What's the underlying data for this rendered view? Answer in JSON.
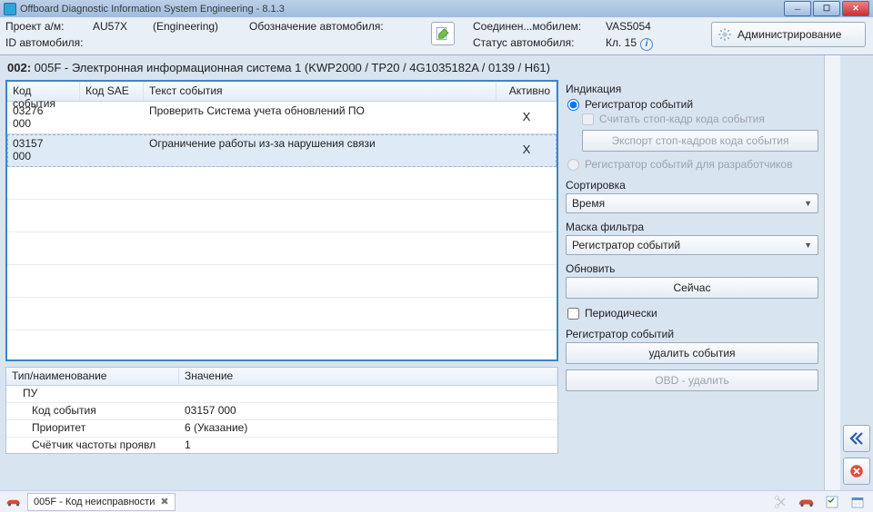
{
  "window": {
    "title": "Offboard Diagnostic Information System Engineering - 8.1.3"
  },
  "header": {
    "project_label": "Проект а/м:",
    "project_value": "AU57X",
    "project_mode": "(Engineering)",
    "vehicle_desig_label": "Обозначение автомобиля:",
    "vehicle_id_label": "ID автомобиля:",
    "conn_label": "Соединен...мобилем:",
    "conn_value": "VAS5054",
    "status_label": "Статус автомобиля:",
    "status_value": "Кл. 15",
    "admin_btn": "Администрирование"
  },
  "ecu_title": {
    "ord": "002:",
    "rest": "005F - Электронная информационная система 1  (KWP2000 / TP20 / 4G1035182A / 0139 / H61)"
  },
  "event_table": {
    "cols": {
      "code": "Код события",
      "sae": "Код SAE",
      "text": "Текст события",
      "active": "Активно"
    },
    "rows": [
      {
        "code1": "03276",
        "code2": "000",
        "sae": "",
        "text": "Проверить Система учета обновлений ПО",
        "active": "X",
        "selected": false
      },
      {
        "code1": "03157",
        "code2": "000",
        "sae": "",
        "text": "Ограничение работы из-за нарушения связи",
        "active": "X",
        "selected": true
      }
    ]
  },
  "details": {
    "cols": {
      "name": "Тип/наименование",
      "value": "Значение"
    },
    "rows": [
      {
        "lvl": 0,
        "name": "ПУ",
        "value": ""
      },
      {
        "lvl": 1,
        "name": "Код события",
        "value": "03157 000"
      },
      {
        "lvl": 1,
        "name": "Приоритет",
        "value": "6  (Указание)"
      },
      {
        "lvl": 1,
        "name": "Счётчик частоты проявл",
        "value": "1"
      }
    ]
  },
  "side": {
    "indication_label": "Индикация",
    "radio_event_log": "Регистратор событий",
    "chk_read_freeze": "Считать стоп-кадр кода события",
    "btn_export_freeze": "Экспорт стоп-кадров кода события",
    "radio_dev_log": "Регистратор событий для разработчиков",
    "sort_label": "Сортировка",
    "sort_value": "Время",
    "mask_label": "Маска фильтра",
    "mask_value": "Регистратор событий",
    "refresh_label": "Обновить",
    "btn_now": "Сейчас",
    "chk_periodic": "Периодически",
    "log_section": "Регистратор событий",
    "btn_delete_events": "удалить события",
    "btn_obd_delete": "OBD - удалить"
  },
  "tab": {
    "label": "005F - Код неисправности"
  }
}
